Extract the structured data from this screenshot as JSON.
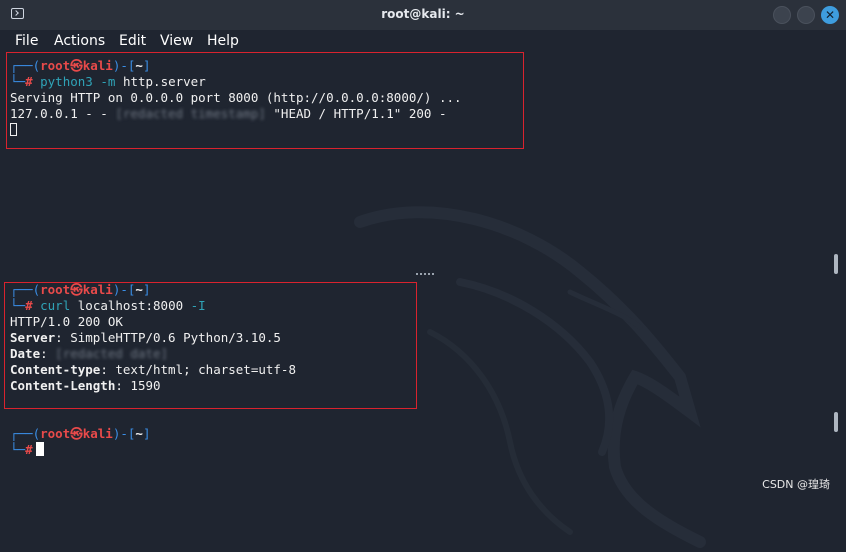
{
  "window": {
    "title": "root@kali: ~",
    "close_glyph": "✕"
  },
  "menu": [
    "File",
    "Actions",
    "Edit",
    "View",
    "Help"
  ],
  "prompt": {
    "user": "root",
    "at": "㉿",
    "host": "kali",
    "dir": "~",
    "hash": "#"
  },
  "pane1": {
    "command_name": "python3",
    "command_flag": "-m",
    "command_arg": "http.server",
    "output1": "Serving HTTP on 0.0.0.0 port 8000 (http://0.0.0.0:8000/) ...",
    "log_prefix": "127.0.0.1 - - ",
    "log_redacted": "[redacted timestamp]",
    "log_suffix": " \"HEAD / HTTP/1.1\" 200 -"
  },
  "pane2": {
    "command_name": "curl",
    "command_arg": "localhost:8000",
    "command_flag": "-I",
    "status_line": "HTTP/1.0 200 OK",
    "headers": [
      {
        "name": "Server",
        "value": " SimpleHTTP/0.6 Python/3.10.5"
      },
      {
        "name": "Date",
        "value": "[redacted date]"
      },
      {
        "name": "Content-type",
        "value": " text/html; charset=utf-8"
      },
      {
        "name": "Content-Length",
        "value": " 1590"
      }
    ]
  },
  "watermark": "CSDN @瑝琦",
  "colors": {
    "background": "#1f2530",
    "prompt_bracket": "#3a8ee6",
    "prompt_user": "#e84a4a",
    "command_args": "#2fa3b7",
    "highlight_box": "#d9232e"
  }
}
